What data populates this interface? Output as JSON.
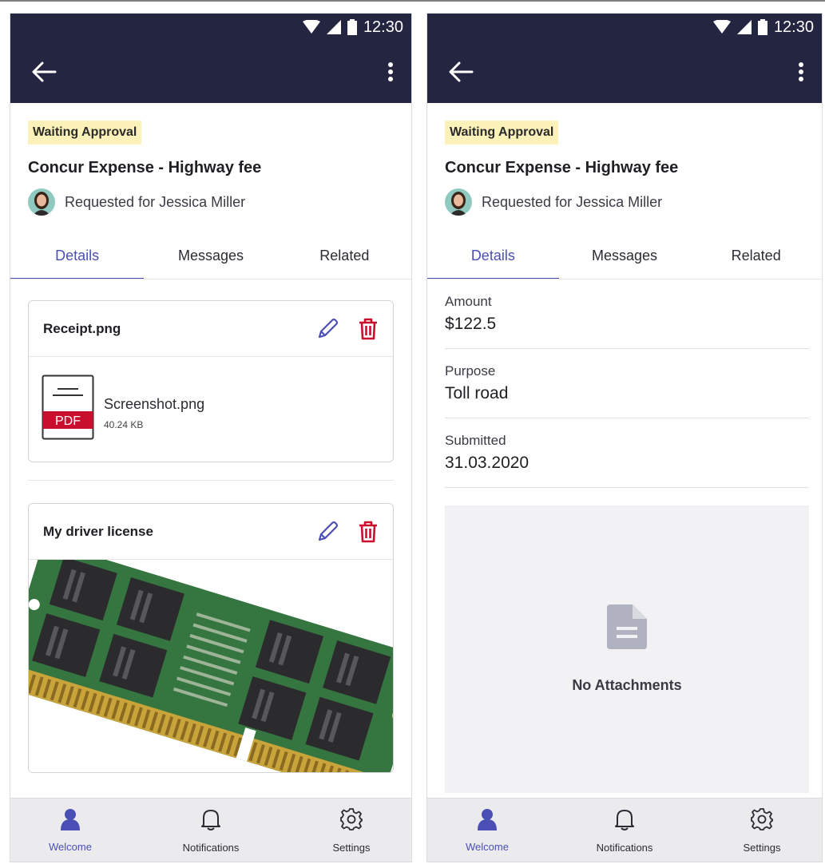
{
  "status_bar": {
    "time": "12:30"
  },
  "badge": "Waiting Approval",
  "title": "Concur Expense - Highway fee",
  "requested_for": "Requested for Jessica Miller",
  "tabs": [
    {
      "label": "Details",
      "active": true
    },
    {
      "label": "Messages",
      "active": false
    },
    {
      "label": "Related",
      "active": false
    }
  ],
  "attachments": [
    {
      "title": "Receipt.png",
      "file_name": "Screenshot.png",
      "file_size": "40.24 KB",
      "file_icon_label": "PDF"
    },
    {
      "title": "My driver license"
    }
  ],
  "details": [
    {
      "label": "Amount",
      "value": "$122.5"
    },
    {
      "label": "Purpose",
      "value": "Toll road"
    },
    {
      "label": "Submitted",
      "value": "31.03.2020"
    }
  ],
  "no_attachments": "No Attachments",
  "bottom_nav": [
    {
      "label": "Welcome",
      "icon": "person-icon",
      "active": true
    },
    {
      "label": "Notifications",
      "icon": "bell-icon",
      "active": false
    },
    {
      "label": "Settings",
      "icon": "gear-icon",
      "active": false
    }
  ],
  "colors": {
    "appbar": "#242540",
    "accent": "#4a4fb5",
    "delete": "#c8102e",
    "badge_bg": "#fbf1b9"
  }
}
